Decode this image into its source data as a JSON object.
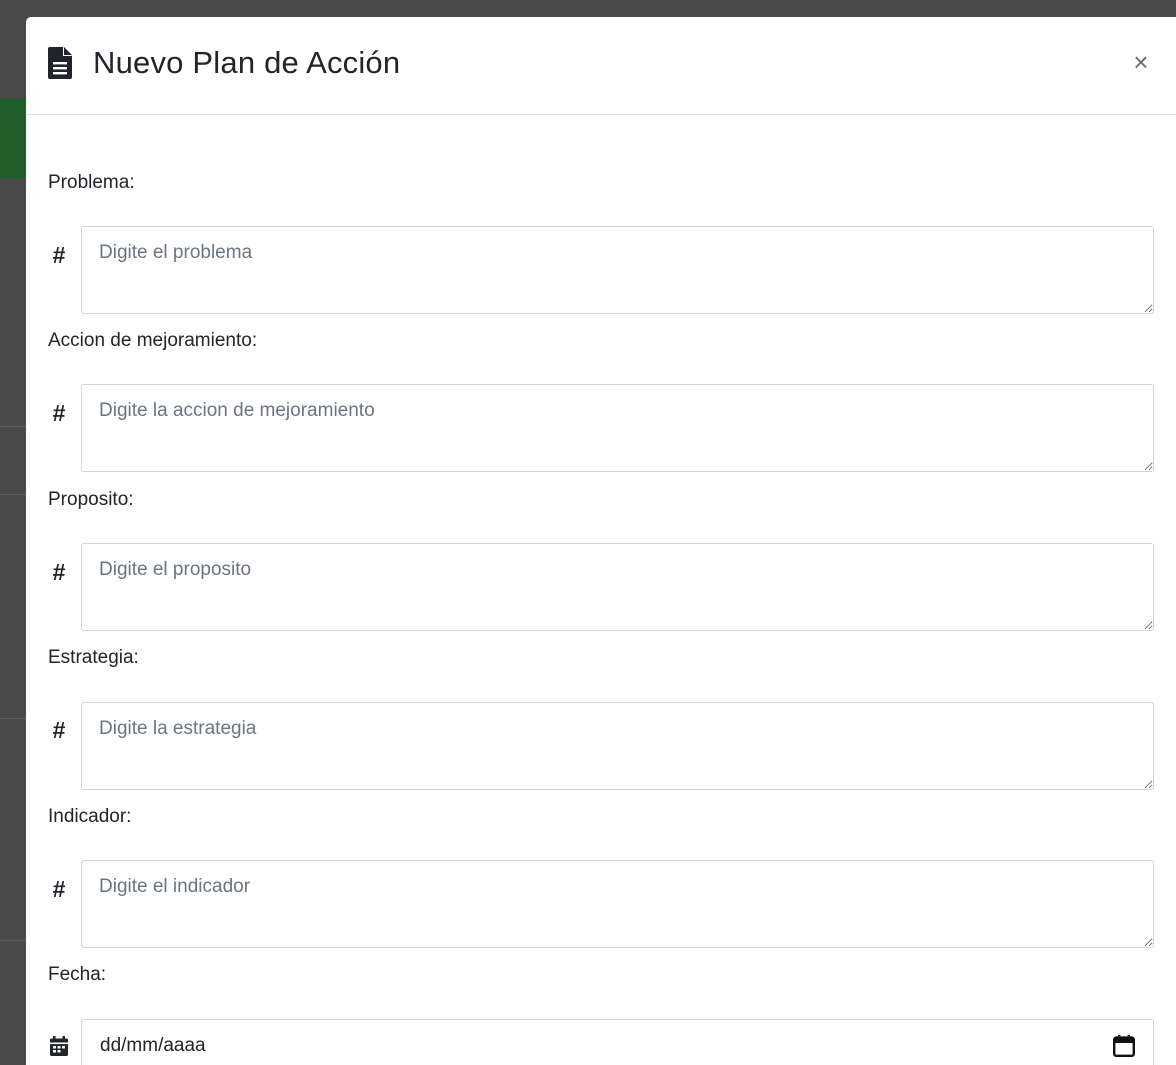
{
  "modal": {
    "title": "Nuevo Plan de Acción",
    "title_icon": "file-alt-icon",
    "close_label": "×"
  },
  "fields": [
    {
      "label": "Problema:",
      "prefix": "#",
      "placeholder": "Digite el problema",
      "value": ""
    },
    {
      "label": "Accion de mejoramiento:",
      "prefix": "#",
      "placeholder": "Digite la accion de mejoramiento",
      "value": ""
    },
    {
      "label": "Proposito:",
      "prefix": "#",
      "placeholder": "Digite el proposito",
      "value": ""
    },
    {
      "label": "Estrategia:",
      "prefix": "#",
      "placeholder": "Digite la estrategia",
      "value": ""
    },
    {
      "label": "Indicador:",
      "prefix": "#",
      "placeholder": "Digite el indicador",
      "value": ""
    }
  ],
  "date_field": {
    "label": "Fecha:",
    "prefix_icon": "calendar-icon",
    "placeholder": "dd/mm/aaaa",
    "picker_icon": "calendar-picker-icon"
  },
  "colors": {
    "backdrop": "#4a4a4a",
    "text": "#212529",
    "border": "#ced4da",
    "placeholder": "#6c757d"
  }
}
